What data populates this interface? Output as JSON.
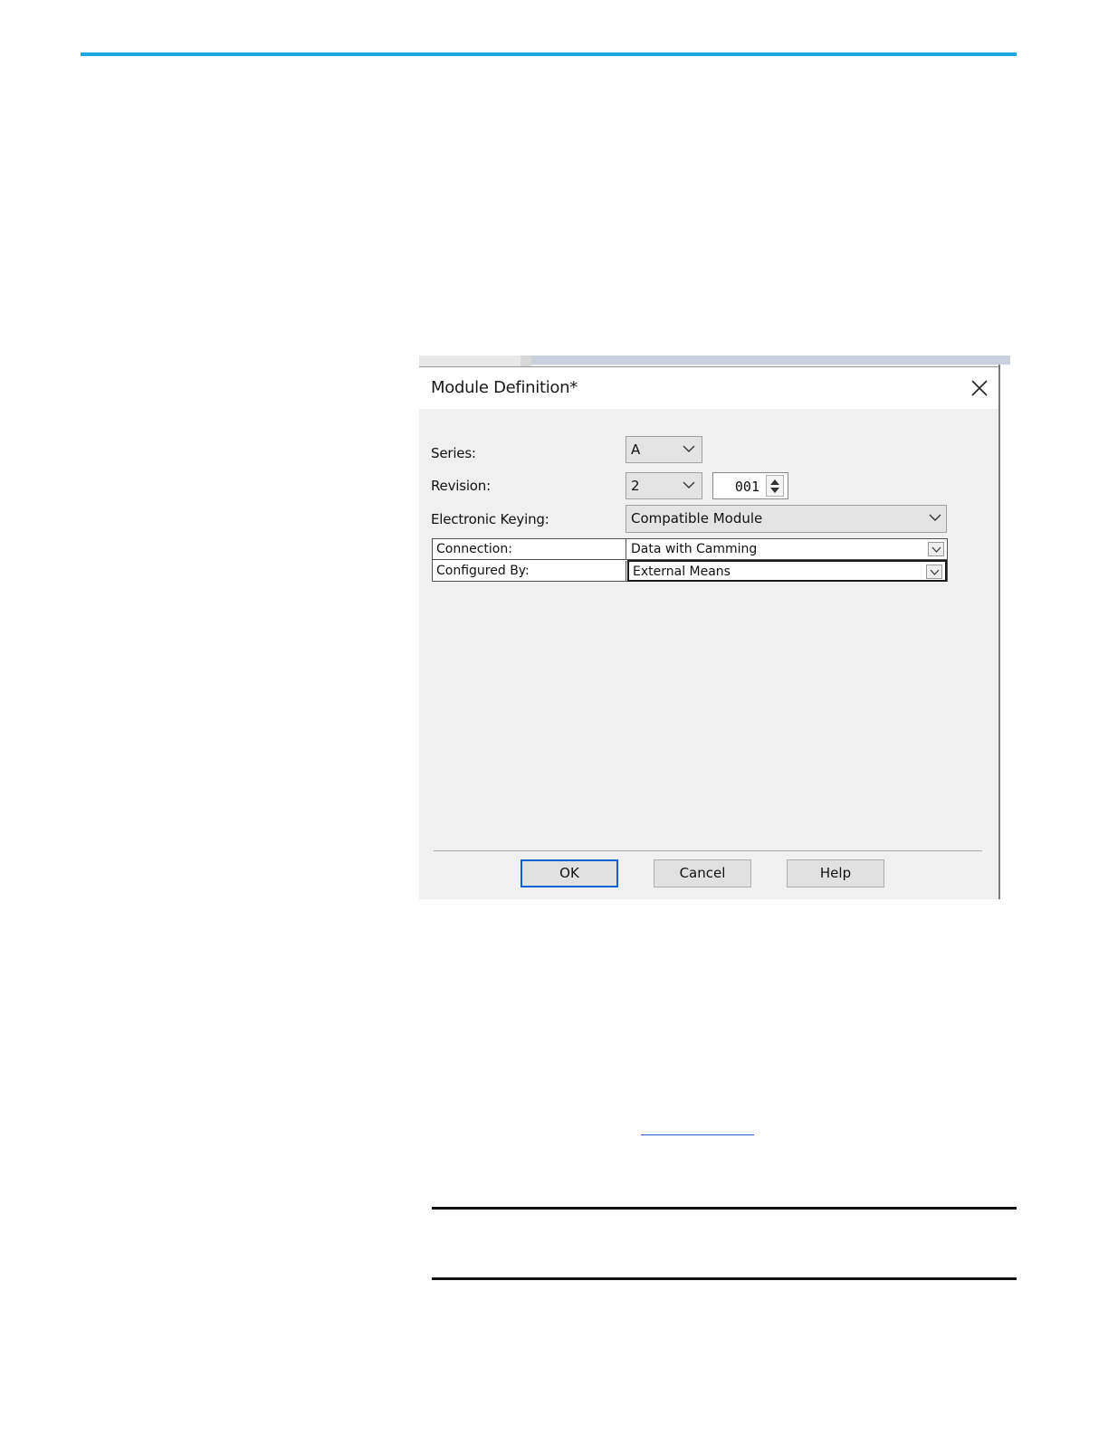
{
  "dialog": {
    "title": "Module Definition*",
    "close_icon": "close-icon",
    "fields": {
      "series_label": "Series:",
      "series_value": "A",
      "revision_label": "Revision:",
      "revision_major": "2",
      "revision_minor": "001",
      "keying_label": "Electronic Keying:",
      "keying_value": "Compatible Module"
    },
    "grid": [
      {
        "label": "Connection:",
        "value": "Data with Camming"
      },
      {
        "label": "Configured By:",
        "value": "External Means"
      }
    ],
    "buttons": {
      "ok": "OK",
      "cancel": "Cancel",
      "help": "Help"
    }
  },
  "colors": {
    "accent_rule": "#1fa9e1",
    "ok_focus_border": "#0d62d6",
    "link_underline": "#2a5bd7"
  }
}
